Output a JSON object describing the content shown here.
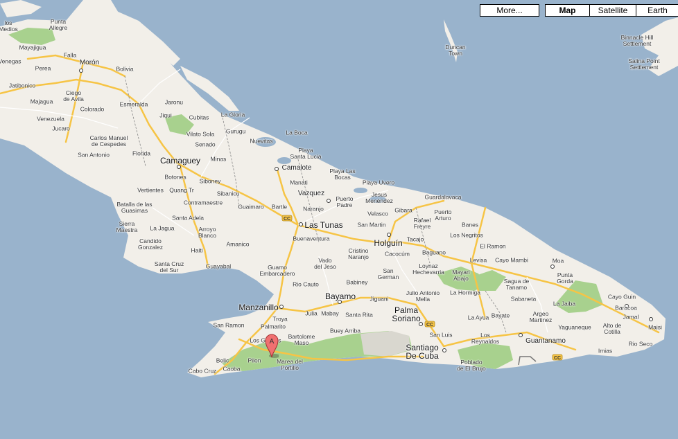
{
  "controls": {
    "more": "More...",
    "map": "Map",
    "satellite": "Satellite",
    "earth": "Earth",
    "active": "Map"
  },
  "marker": {
    "label": "A",
    "color": "#f07070"
  },
  "colors": {
    "water": "#99b3cc",
    "land": "#f2efe9",
    "park": "#a8d18e",
    "highway": "#f6c445",
    "road": "#ffffff"
  },
  "shields": [
    "CC",
    "CC",
    "CC"
  ],
  "labels": {
    "punta_alegre": "Punta\nAllegre",
    "los_medios": "los\nMedios",
    "mayajigua": "Mayajigua",
    "falla": "Falla",
    "venegas": "Venegas",
    "perea": "Perea",
    "moron": "Morón",
    "bolivia": "Bolivia",
    "jatibonico": "Jatibonico",
    "ciego_de_avila": "Ciego\nde Avila",
    "majagua": "Majagua",
    "colorado": "Colorado",
    "venezuela": "Venezuela",
    "jucaro": "Jucaro",
    "esmeralda": "Esmeralda",
    "jaronu": "Jaronu",
    "jiqui": "Jiqui",
    "cubitas": "Cubitas",
    "la_gloria": "La Gloria",
    "vilato_sola": "Vilato Sola",
    "carlos_manuel": "Carlos Manuel\nde Cespedes",
    "san_antonio": "San Antonio",
    "florida": "Florida",
    "senado": "Senado",
    "gurugu": "Gurugu",
    "nuevitas": "Nuevitas",
    "la_boca": "La Boca",
    "playa_santa_lucia": "Playa\nSanta Lucia",
    "camaguey": "Camaguey",
    "minas": "Minas",
    "camalote": "Camalote",
    "playa_las_bocas": "Playa Las\nBocas",
    "playa_uvero": "Playa Uvero",
    "botones": "Botones",
    "quang_tr": "Quang Tr",
    "vertientes": "Vertientes",
    "siboney": "Siboney",
    "sibanicu": "Sibanicu",
    "manati": "Manati",
    "vazquez": "Vazquez",
    "jesus_menendez": "Jesus\nMenéndez",
    "guardalavaca": "Guardalavaca",
    "puerto_padre": "Puerto\nPadre",
    "contramaestre": "Contramaestre",
    "guaimaro": "Guaimaro",
    "bartle": "Bartle",
    "naranjo": "Naranjo",
    "gibara": "Gibara",
    "banes": "Banes",
    "batalla": "Batalla de las\nGuasimas",
    "santa_adela": "Santa Adela",
    "las_tunas": "Las Tunas",
    "velasco": "Velasco",
    "rafael_freyre": "Rafael\nFreyre",
    "puerto_arturo": "Puerto\nArturo",
    "sierra_maestra": "Sierra\nMaestra",
    "la_jagua": "La Jagua",
    "arroyo_blanco": "Arroyo\nBlanco",
    "san_martin": "San Martin",
    "candido_gonzalez": "Candido\nGonzalez",
    "buenaventura": "Buenaventura",
    "holguin": "Holguín",
    "tacajo": "Tacajo",
    "los_negritos": "Los Negritos",
    "el_ramon": "El Ramon",
    "haiti": "Haiti",
    "amanico": "Amanico",
    "cristino_naranjo": "Cristino\nNaranjo",
    "cacocum": "Cacocúm",
    "baguano": "Baguano",
    "santa_cruz": "Santa Cruz\ndel Sur",
    "guayabal": "Guayabal",
    "guamo_embarcadero": "Guamo\nEmbarcadero",
    "vado_del_jeso": "Vado\ndel Jeso",
    "san_german": "San\nGerman",
    "loynaz": "Loynaz\nHechevarria",
    "levisa": "Levisa",
    "cayo_mambi": "Cayo Mambi",
    "moa": "Moa",
    "mayari_abajo": "Mayari\nAbajo",
    "rio_cauto": "Rio Cauto",
    "babiney": "Babiney",
    "sagua": "Sagua de\nTanamo",
    "punta_gorda": "Punta\nGorda",
    "bayamo": "Bayamo",
    "jiguani": "Jiguani",
    "julio_antonio_mella": "Julio Antonio\nMella",
    "la_hormiga": "La Hormiga",
    "sabaneta": "Sabaneta",
    "la_jaiba": "La Jaiba",
    "cayo_guin": "Cayo Guin",
    "manzanillo": "Manzanillo",
    "baracoa": "Baracoa",
    "palma_soriano": "Palma\nSoriano",
    "julia": "Julia",
    "mabay": "Mabay",
    "santa_rita": "Santa Rita",
    "la_ayua": "La Ayua",
    "bayate": "Bayate",
    "argeo_martinez": "Argeo\nMartinez",
    "jamal": "Jamal",
    "yaguaneque": "Yaguaneque",
    "alto_de_cotilla": "Alto de\nCotilla",
    "maisi": "Maisi",
    "san_ramon": "San Ramon",
    "troya": "Troya",
    "palmarito": "Palmarito",
    "bartolome_maso": "Bartolome\nMaso",
    "buey_arriba": "Buey Arriba",
    "san_luis": "San Luis",
    "los_reynaldos": "Los\nReynaldos",
    "guantanamo": "Guantanamo",
    "rio_seco": "Rio Seco",
    "los_guayos": "Los Guayos",
    "santiago": "Santiago\nDe Cuba",
    "poblado": "Poblado\nde El Brujo",
    "imias": "Imias",
    "belic": "Belic",
    "pilon": "Pilon",
    "marea": "Marea del\nPortillo",
    "cabo_cruz": "Cabo Cruz",
    "caoba": "Caoba",
    "duncan_town": "Duncan\nTown",
    "binnacle": "Binnacle Hill\nSettlement",
    "salina_point": "Salina Point\nSettlement"
  }
}
